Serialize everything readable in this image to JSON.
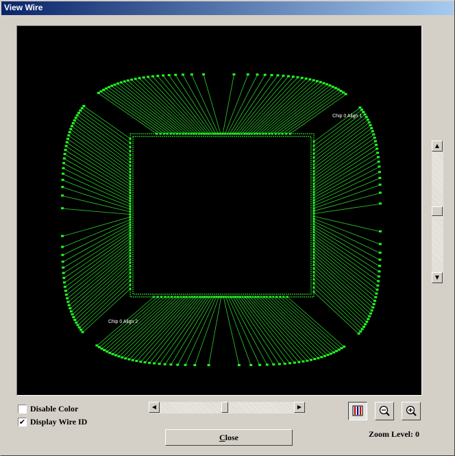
{
  "window": {
    "title": "View Wire"
  },
  "view": {
    "wire_color": "#2cd32c",
    "pad_color": "#22ff22",
    "background": "#000000",
    "labels": [
      {
        "text": "Chip 0 Align 1"
      },
      {
        "text": "Chip 0 Align 2"
      }
    ]
  },
  "options": {
    "disable_color": {
      "label": "Disable Color",
      "checked": false
    },
    "display_wire_id": {
      "label": "Display Wire ID",
      "checked": true
    }
  },
  "buttons": {
    "close_underlined": "C",
    "close_rest": "lose"
  },
  "toolbar": {
    "icons": [
      "wire-color-icon",
      "zoom-out-icon",
      "zoom-in-icon"
    ]
  },
  "zoom": {
    "label": "Zoom Level: 0"
  },
  "check_glyph": "✔"
}
